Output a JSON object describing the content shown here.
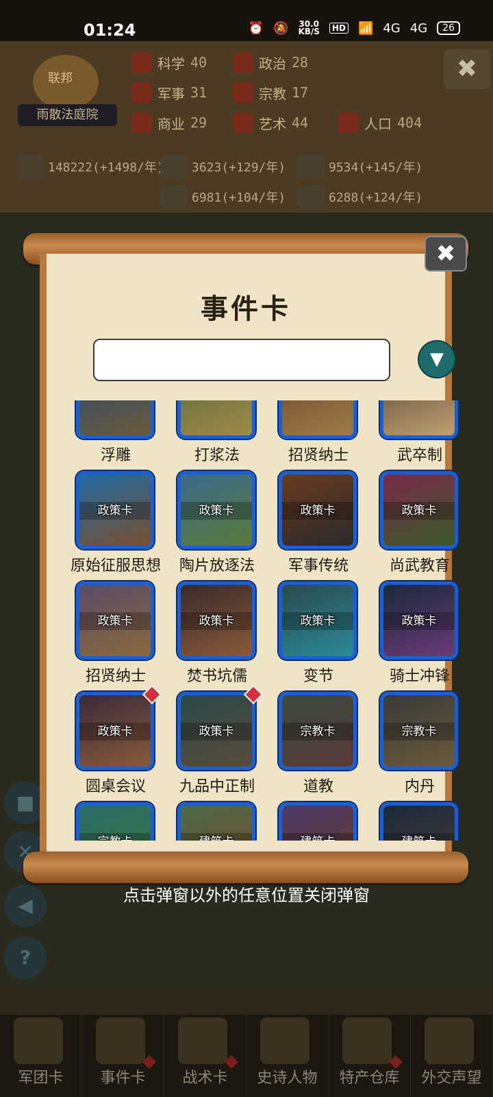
{
  "status_bar": {
    "time": "01:24",
    "speed_value": "30.0",
    "speed_unit": "KB/S",
    "hd_label": "HD",
    "network_1": "4G",
    "network_2": "4G",
    "battery": "26"
  },
  "background": {
    "alliance_emblem": "联邦",
    "court_name": "雨散法庭院",
    "stats": [
      {
        "label": "科学",
        "value": "40"
      },
      {
        "label": "政治",
        "value": "28"
      },
      {
        "label": "军事",
        "value": "31"
      },
      {
        "label": "宗教",
        "value": "17"
      },
      {
        "label": "商业",
        "value": "29"
      },
      {
        "label": "艺术",
        "value": "44"
      },
      {
        "label": "人口",
        "value": "404"
      }
    ],
    "resources": [
      "148222(+1498/年)",
      "3623(+129/年)",
      "9534(+145/年)",
      "6981(+104/年)",
      "6288(+124/年)"
    ],
    "close_icon": "✖",
    "help_icon": "?"
  },
  "popup": {
    "title": "事件卡",
    "search_value": "",
    "search_placeholder": "",
    "filter_icon": "▼",
    "close_icon": "✖",
    "cards": [
      {
        "name": "浮雕",
        "tag": "",
        "badge": false,
        "art": [
          "#2c4a6e",
          "#6b5a3a"
        ]
      },
      {
        "name": "打浆法",
        "tag": "",
        "badge": false,
        "art": [
          "#5a6a3a",
          "#a08a4a"
        ]
      },
      {
        "name": "招贤纳士",
        "tag": "",
        "badge": false,
        "art": [
          "#6a4a2a",
          "#a07a4a"
        ]
      },
      {
        "name": "武卒制",
        "tag": "",
        "badge": false,
        "art": [
          "#5a4a3a",
          "#c0a070"
        ]
      },
      {
        "name": "原始征服思想",
        "tag": "政策卡",
        "badge": false,
        "art": [
          "#1f6aa0",
          "#7a5030"
        ]
      },
      {
        "name": "陶片放逐法",
        "tag": "政策卡",
        "badge": false,
        "art": [
          "#3a6a8a",
          "#5a7a3a"
        ]
      },
      {
        "name": "军事传统",
        "tag": "政策卡",
        "badge": false,
        "art": [
          "#6a3a20",
          "#2a2a2a"
        ]
      },
      {
        "name": "尚武教育",
        "tag": "政策卡",
        "badge": false,
        "art": [
          "#7a2a4a",
          "#3a5a2a"
        ]
      },
      {
        "name": "招贤纳士",
        "tag": "政策卡",
        "badge": false,
        "art": [
          "#5a4a6a",
          "#8a6a3a"
        ]
      },
      {
        "name": "焚书坑儒",
        "tag": "政策卡",
        "badge": false,
        "art": [
          "#3a2a2a",
          "#8a5a3a"
        ]
      },
      {
        "name": "变节",
        "tag": "政策卡",
        "badge": false,
        "art": [
          "#2a4a4a",
          "#2a8a9a"
        ]
      },
      {
        "name": "骑士冲锋",
        "tag": "政策卡",
        "badge": false,
        "art": [
          "#1a2a3a",
          "#6a3a7a"
        ]
      },
      {
        "name": "圆桌会议",
        "tag": "政策卡",
        "badge": true,
        "art": [
          "#3a2a3a",
          "#8a5a3a"
        ]
      },
      {
        "name": "九品中正制",
        "tag": "政策卡",
        "badge": true,
        "art": [
          "#2a4a4a",
          "#5a4a3a"
        ]
      },
      {
        "name": "道教",
        "tag": "宗教卡",
        "badge": false,
        "art": [
          "#3a4a3a",
          "#5a3a3a"
        ]
      },
      {
        "name": "内丹",
        "tag": "宗教卡",
        "badge": false,
        "art": [
          "#3a3a3a",
          "#6a5a3a"
        ]
      },
      {
        "name": "",
        "tag": "宗教卡",
        "badge": false,
        "art": [
          "#2a6a6a",
          "#3a7a3a"
        ]
      },
      {
        "name": "",
        "tag": "建筑卡",
        "badge": false,
        "art": [
          "#4a6a4a",
          "#7a4a2a"
        ]
      },
      {
        "name": "",
        "tag": "建筑卡",
        "badge": false,
        "art": [
          "#4a3a6a",
          "#6a3a2a"
        ]
      },
      {
        "name": "",
        "tag": "建筑卡",
        "badge": false,
        "art": [
          "#1a2a3a",
          "#4a3a3a"
        ]
      }
    ]
  },
  "close_hint": "点击弹窗以外的任意位置关闭弹窗",
  "bottom_nav": [
    {
      "label": "军团卡",
      "badge": false
    },
    {
      "label": "事件卡",
      "badge": true
    },
    {
      "label": "战术卡",
      "badge": true
    },
    {
      "label": "史诗人物",
      "badge": false
    },
    {
      "label": "特产仓库",
      "badge": true
    },
    {
      "label": "外交声望",
      "badge": false
    }
  ],
  "colors": {
    "card_border": "#1a5fd6",
    "parchment": "#efe4c6",
    "scroll_wood": "#b87a3c",
    "filter_button": "#1f6b6b",
    "new_badge": "#d2313b"
  }
}
